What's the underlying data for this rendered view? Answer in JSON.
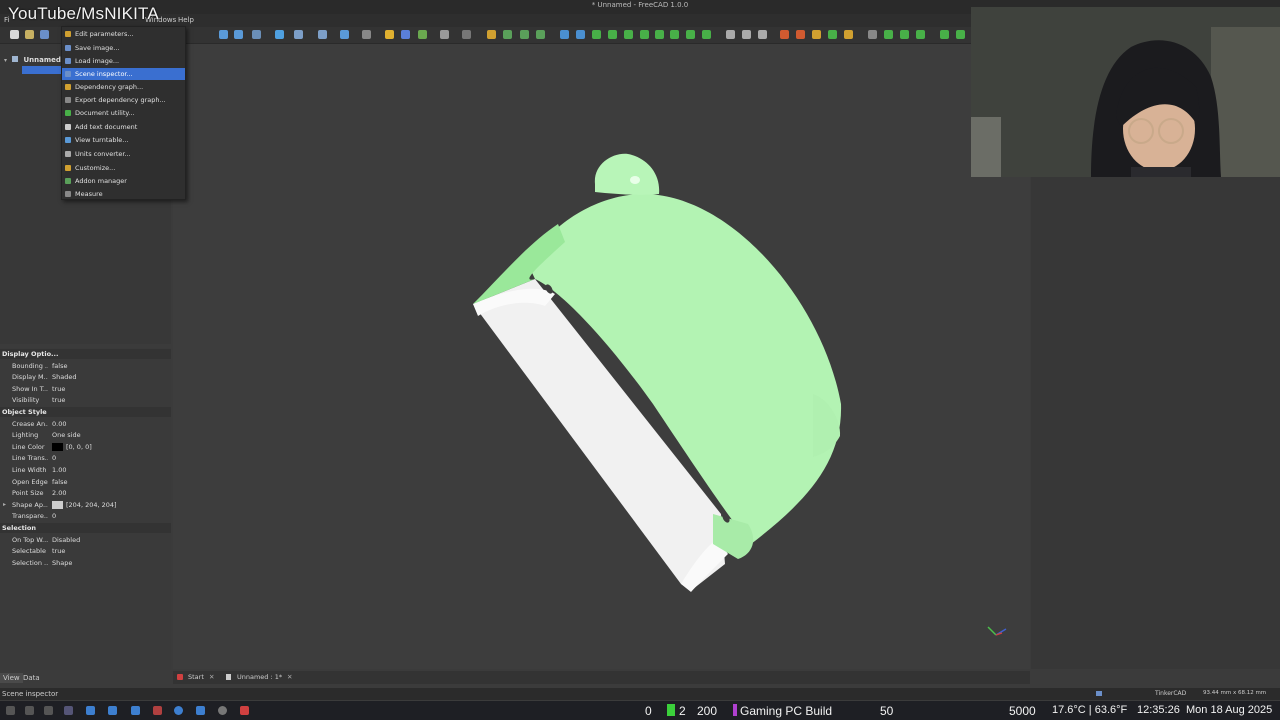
{
  "window": {
    "title": "* Unnamed - FreeCAD 1.0.0"
  },
  "overlay": {
    "watermark": "YouTube/MsNIKITA"
  },
  "menubar": {
    "items": [
      "Fi",
      "Windows",
      "Help"
    ]
  },
  "tools_menu": {
    "items": [
      {
        "label": "Edit parameters..."
      },
      {
        "label": "Save image..."
      },
      {
        "label": "Load image..."
      },
      {
        "label": "Scene inspector...",
        "selected": true
      },
      {
        "label": "Dependency graph..."
      },
      {
        "label": "Export dependency graph..."
      },
      {
        "label": "Document utility..."
      },
      {
        "label": "Add text document"
      },
      {
        "label": "View turntable..."
      },
      {
        "label": "Units converter..."
      },
      {
        "label": "Customize..."
      },
      {
        "label": "Addon manager"
      },
      {
        "label": "Measure"
      }
    ]
  },
  "tree": {
    "root_label": "Unnamed"
  },
  "properties": {
    "groups": [
      {
        "title": "Display Optio...",
        "rows": [
          {
            "name": "Bounding ...",
            "value": "false"
          },
          {
            "name": "Display M...",
            "value": "Shaded"
          },
          {
            "name": "Show In T...",
            "value": "true"
          },
          {
            "name": "Visibility",
            "value": "true"
          }
        ]
      },
      {
        "title": "Object Style",
        "rows": [
          {
            "name": "Crease An...",
            "value": "0.00"
          },
          {
            "name": "Lighting",
            "value": "One side"
          },
          {
            "name": "Line Color",
            "value": "[0, 0, 0]",
            "swatch": "#000000"
          },
          {
            "name": "Line Trans...",
            "value": "0"
          },
          {
            "name": "Line Width",
            "value": "1.00"
          },
          {
            "name": "Open Edges",
            "value": "false"
          },
          {
            "name": "Point Size",
            "value": "2.00"
          },
          {
            "name": "Shape Ap...",
            "value": "[204, 204, 204]",
            "swatch": "#cccccc",
            "expandable": true
          },
          {
            "name": "Transpare...",
            "value": "0"
          }
        ]
      },
      {
        "title": "Selection",
        "rows": [
          {
            "name": "On Top W...",
            "value": "Disabled"
          },
          {
            "name": "Selectable",
            "value": "true"
          },
          {
            "name": "Selection ...",
            "value": "Shape"
          }
        ]
      }
    ]
  },
  "panel_tabs": {
    "view": "View",
    "data": "Data"
  },
  "doc_tabs": {
    "start": "Start",
    "unnamed": "Unnamed : 1*"
  },
  "statusbar": {
    "text": "Scene inspector",
    "nav": "TinkerCAD",
    "dims": "93.44 mm x 68.12 mm"
  },
  "taskbar": {
    "n0": "0",
    "n2": "2",
    "n200": "200",
    "build": "Gaming PC Build",
    "n50": "50",
    "n5000": "5000",
    "weather": "17.6°C | 63.6°F",
    "time": "12:35:26",
    "date": "Mon 18 Aug 2025"
  },
  "colors": {
    "model_face": "#b3f3b3",
    "model_edge": "#f2f2f2",
    "selection": "#3a6fd0"
  },
  "icons": [
    "new-file-icon",
    "open-file-icon",
    "save-icon",
    "zoom-icon",
    "view-cube-icon",
    "gear-icon"
  ]
}
